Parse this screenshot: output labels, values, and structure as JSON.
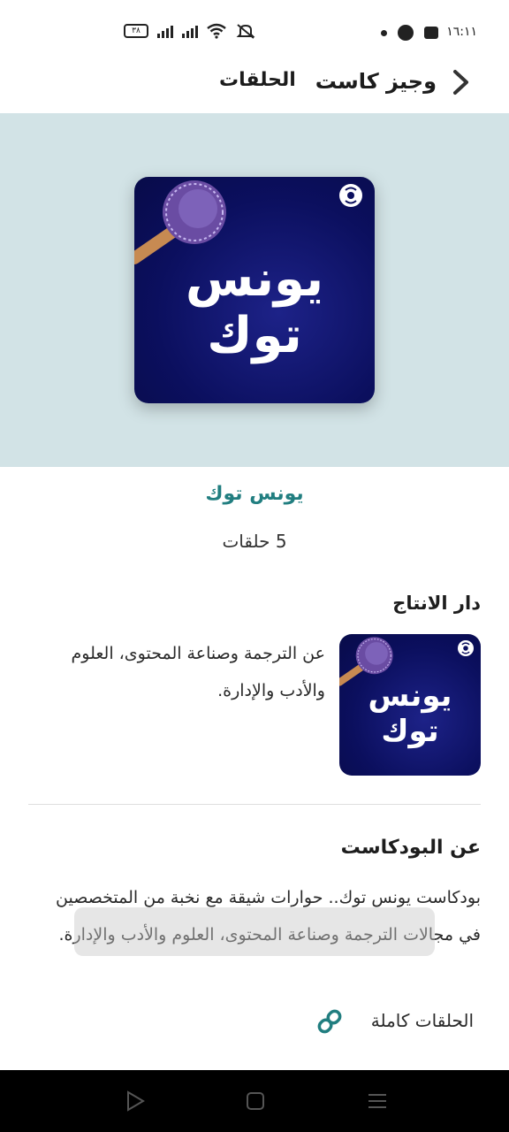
{
  "status_bar": {
    "time": "١٦:١١",
    "battery": "٣٨"
  },
  "header": {
    "brand": "وجيز كاست",
    "episodes_link": "الحلقات"
  },
  "podcast": {
    "cover_text": "يونس توك",
    "name": "يونس توك",
    "episode_count": "5 حلقات"
  },
  "producer": {
    "heading": "دار الانتاج",
    "description": "عن الترجمة وصناعة المحتوى، العلوم والأدب والإدارة."
  },
  "about": {
    "heading": "عن البودكاست",
    "description": "بودكاست يونس توك.. حوارات شيقة مع نخبة من المتخصصين في مجالات الترجمة وصناعة المحتوى، العلوم والأدب والإدارة."
  },
  "links": {
    "full_episodes": "الحلقات كاملة"
  },
  "colors": {
    "accent": "#217e80",
    "hero_bg": "#d2e3e6",
    "cover_bg": "#0b0f5e"
  }
}
